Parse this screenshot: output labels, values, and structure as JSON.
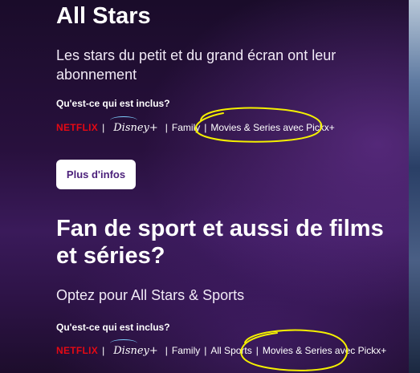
{
  "section1": {
    "title": "All Stars",
    "subtitle": "Les stars du petit et du grand écran ont leur abonnement",
    "included_label": "Qu'est-ce qui est inclus?",
    "providers": {
      "netflix": "NETFLIX",
      "disney": "Disney+",
      "items": [
        "Family",
        "Movies & Series avec Pickx+"
      ],
      "separator": "|"
    },
    "button_label": "Plus d'infos"
  },
  "section2": {
    "title": "Fan de sport et aussi de films et séries?",
    "subtitle": "Optez pour All Stars & Sports",
    "included_label": "Qu'est-ce qui est inclus?",
    "providers": {
      "netflix": "NETFLIX",
      "disney": "Disney+",
      "items": [
        "Family",
        "All Sports",
        "Movies & Series avec Pickx+"
      ],
      "separator": "|"
    }
  },
  "colors": {
    "netflix_red": "#e50914",
    "button_text": "#4b1f7a",
    "annotation": "#f4f000"
  }
}
